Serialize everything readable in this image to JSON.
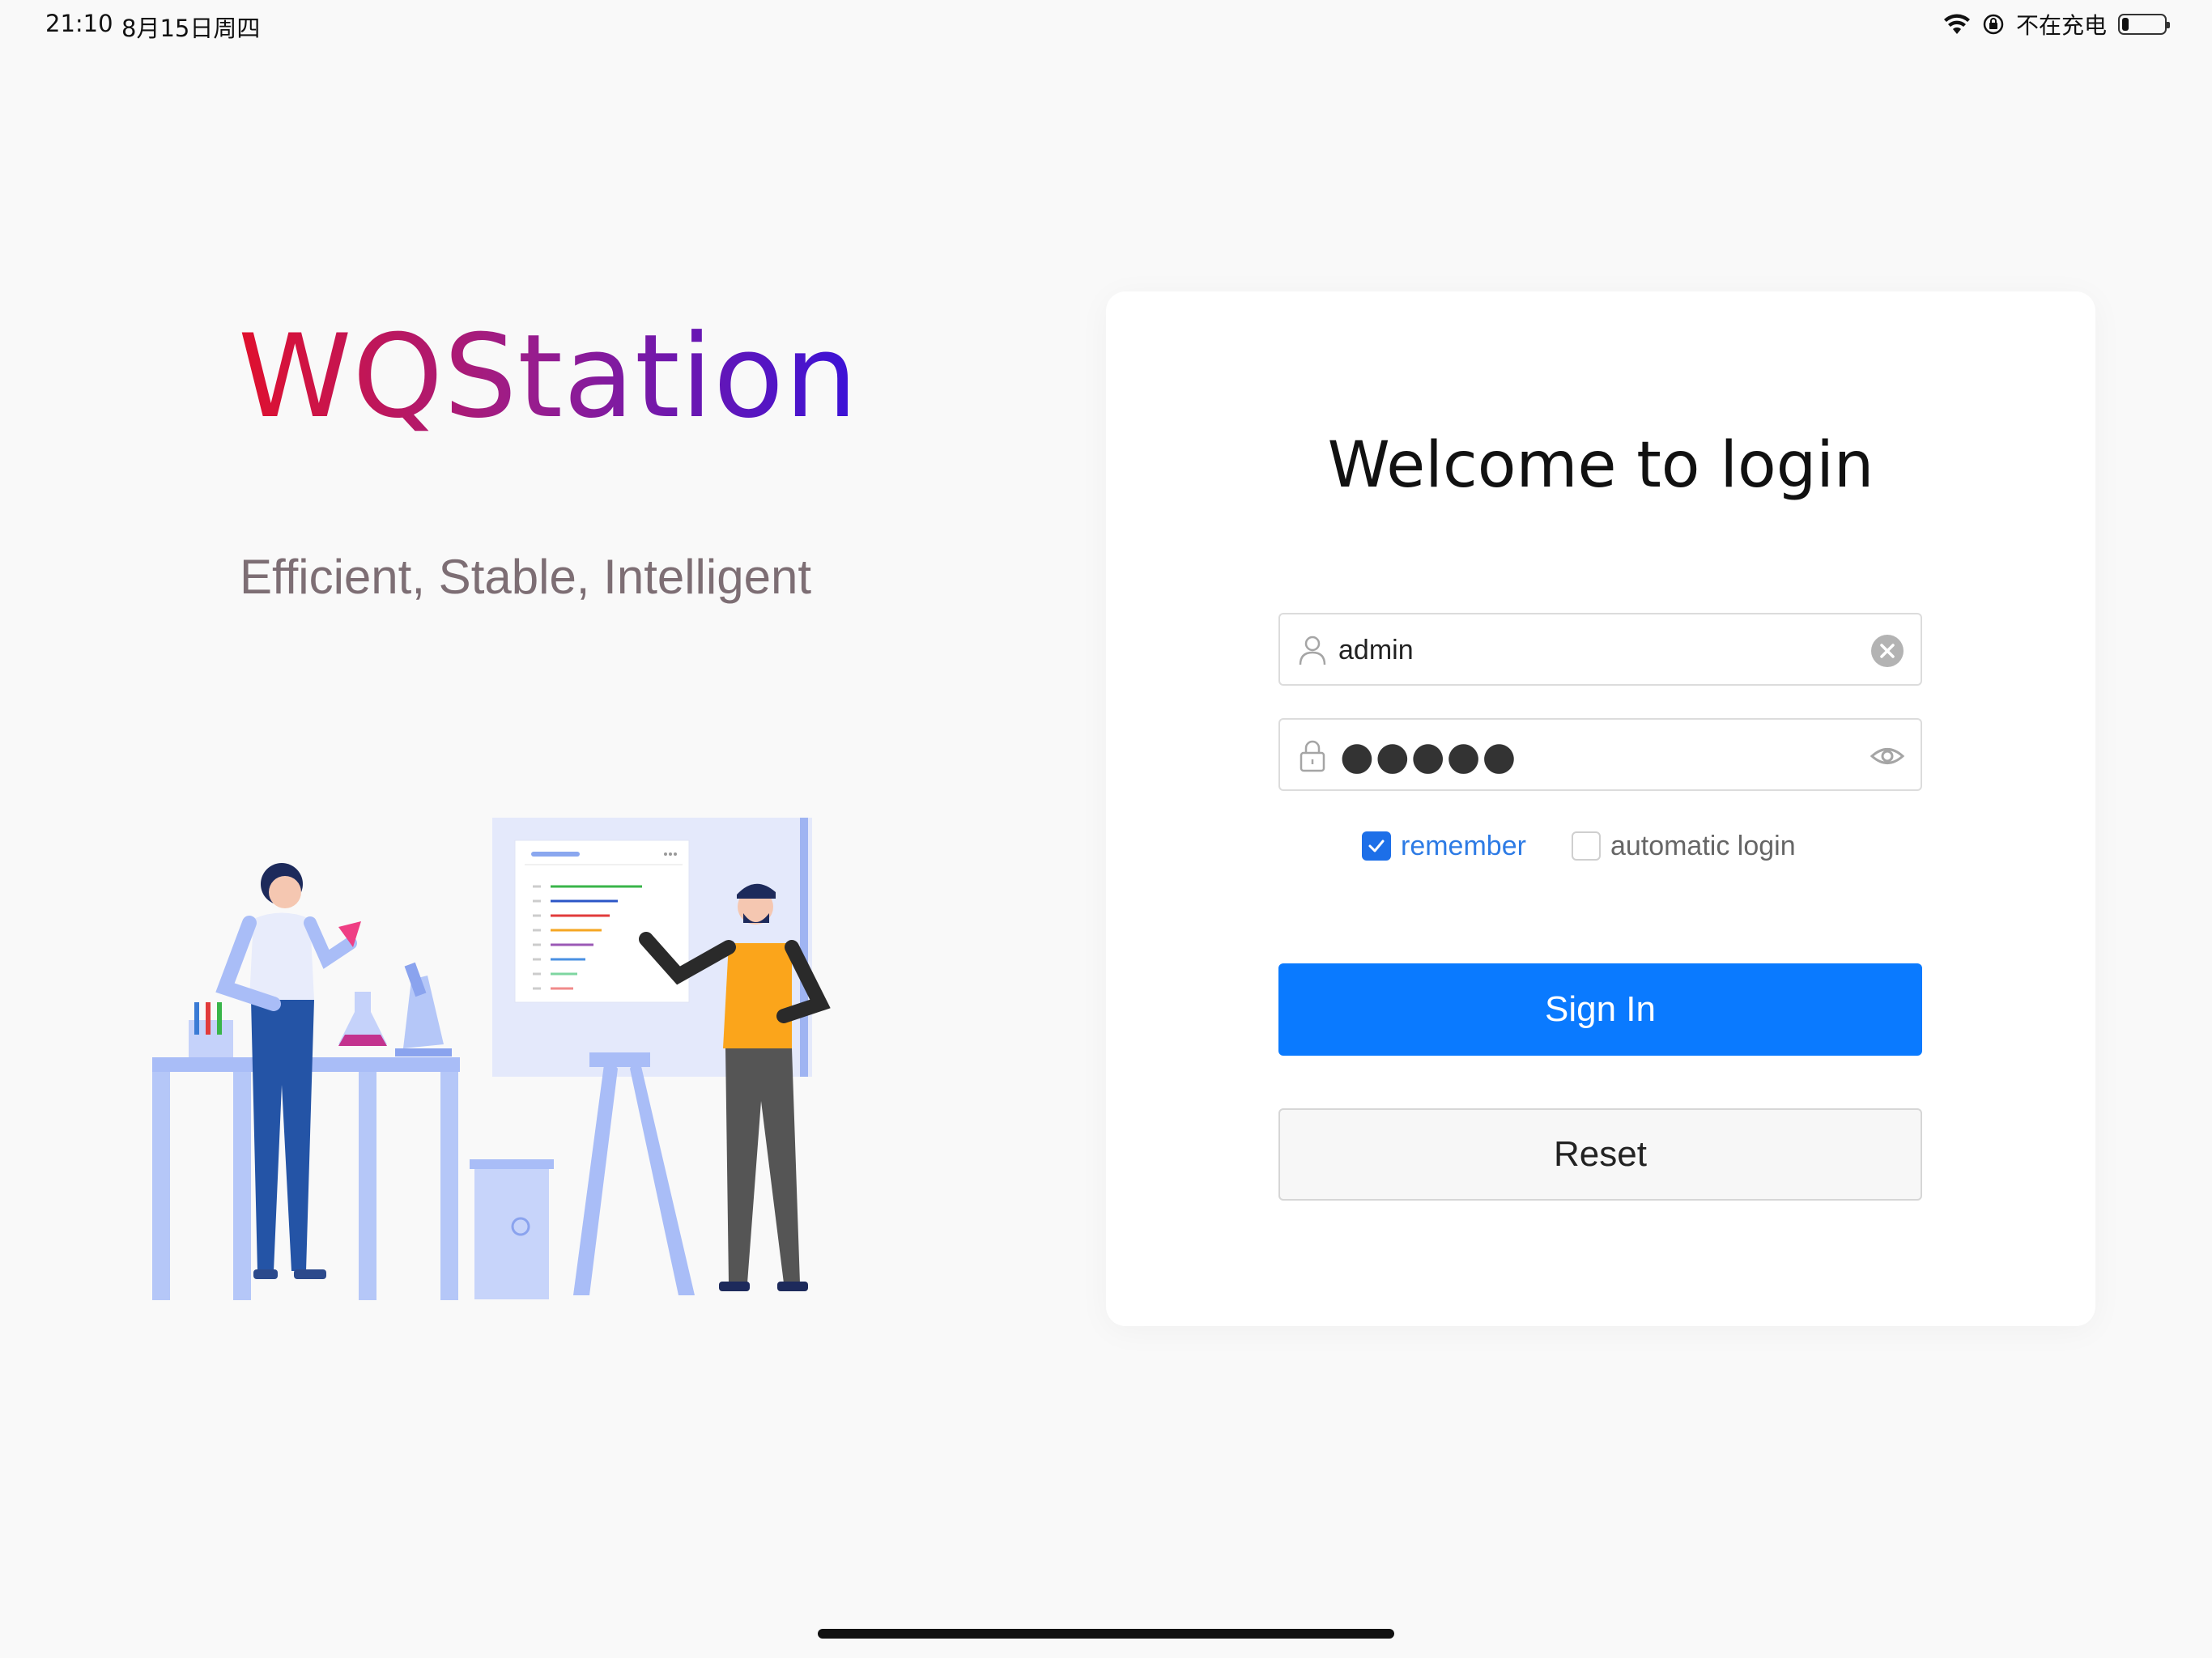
{
  "status_bar": {
    "time": "21:10",
    "date": "8月15日周四",
    "charging_text": "不在充电",
    "battery_level": 0.15,
    "icons": [
      "wifi-icon",
      "orientation-lock-icon",
      "battery-icon"
    ]
  },
  "brand": {
    "title": "WQStation",
    "slogan": "Efficient, Stable, Intelligent",
    "title_gradient": [
      "#e0102c",
      "#9c1d8a",
      "#3a12d8"
    ]
  },
  "login": {
    "title": "Welcome to login",
    "username_value": "admin",
    "password_masked": "●●●●●",
    "remember_label": "remember",
    "remember_checked": true,
    "auto_login_label": "automatic login",
    "auto_login_checked": false,
    "sign_in_label": "Sign In",
    "reset_label": "Reset"
  },
  "colors": {
    "primary": "#0a7aff",
    "checkbox_active": "#1d6fe8",
    "background": "#f9f9f9"
  }
}
